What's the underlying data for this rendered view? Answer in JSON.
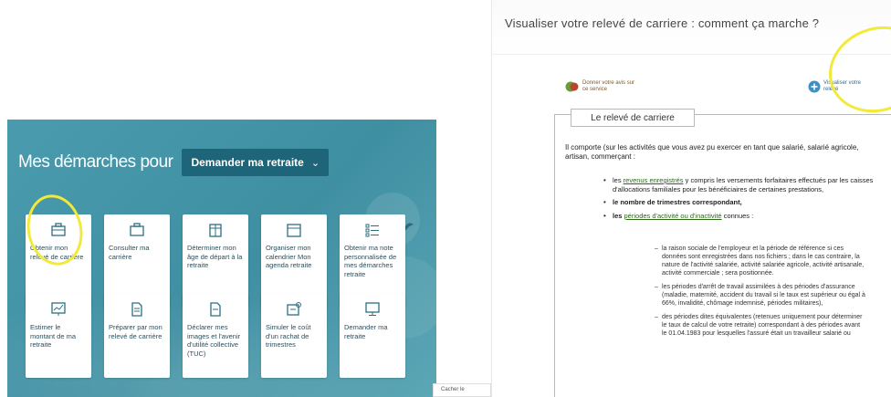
{
  "left": {
    "title": "Mes démarches pour",
    "dropdown": {
      "label": "Demander ma retraite",
      "chevron": "⌄"
    },
    "cards_row1": [
      {
        "icon": "briefcase-icon",
        "label": "Obtenir mon relevé de carrière"
      },
      {
        "icon": "briefcase-icon",
        "label": "Consulter ma carrière"
      },
      {
        "icon": "calendar-icon",
        "label": "Déterminer mon âge de départ à la retraite"
      },
      {
        "icon": "calendar-icon",
        "label": "Organiser mon calendrier Mon agenda retraite"
      },
      {
        "icon": "list-icon",
        "label": "Obtenir ma note personnalisée de mes démarches retraite"
      }
    ],
    "cards_row2": [
      {
        "icon": "chart-icon",
        "label": "Estimer le montant de ma retraite"
      },
      {
        "icon": "document-icon",
        "label": "Préparer par mon relevé de carrière"
      },
      {
        "icon": "document-icon",
        "label": "Déclarer mes images et l'avenir d'utilité collective (TUC)"
      },
      {
        "icon": "settings-icon",
        "label": "Simuler le coût d'un rachat de trimestres"
      },
      {
        "icon": "monitor-icon",
        "label": "Demander ma retraite"
      }
    ]
  },
  "right": {
    "title": "Visualiser votre relevé de carriere : comment ça marche ?",
    "avis_link": "Donner votre avis sur ce service",
    "visualiser_link": "Visualiser votre relevé",
    "legend": "Le relevé de carriere",
    "intro": "Il comporte (sur les activités que vous avez pu exercer en tant que salarié, salarié agricole, artisan, commerçant :",
    "items": [
      {
        "pre": "les ",
        "link": "revenus enregistrés",
        "post": " y compris les versements forfaitaires effectués par les caisses d'allocations familiales pour les bénéficiaires de certaines prestations,"
      },
      {
        "pre": "",
        "bold": "le nombre de trimestres correspondant,",
        "post": ""
      },
      {
        "pre": "les ",
        "link": "périodes d'activité ou d'inactivité",
        "post": " connues :"
      }
    ],
    "subitems": [
      "la raison sociale de l'employeur et la période de référence si ces données sont enregistrées dans nos fichiers ; dans le cas contraire, la nature de l'activité salariée, activité salariée agricole, activité artisanale, activité commerciale ; sera positionnée.",
      "les périodes d'arrêt de travail assimilées à des périodes d'assurance (maladie, maternité, accident du travail si le taux est supérieur ou égal à 66%, invalidité, chômage indemnisé, périodes militaires),",
      "des périodes dites équivalentes (retenues uniquement pour déterminer le taux de calcul de votre retraite) correspondant à des périodes avant le 01.04.1983 pour lesquelles l'assuré était un travailleur salarié ou"
    ],
    "corner": "Cacher le"
  },
  "colors": {
    "panel": "#4a9bae",
    "dropdown": "#1f6579",
    "highlight": "#f2ea3a"
  }
}
